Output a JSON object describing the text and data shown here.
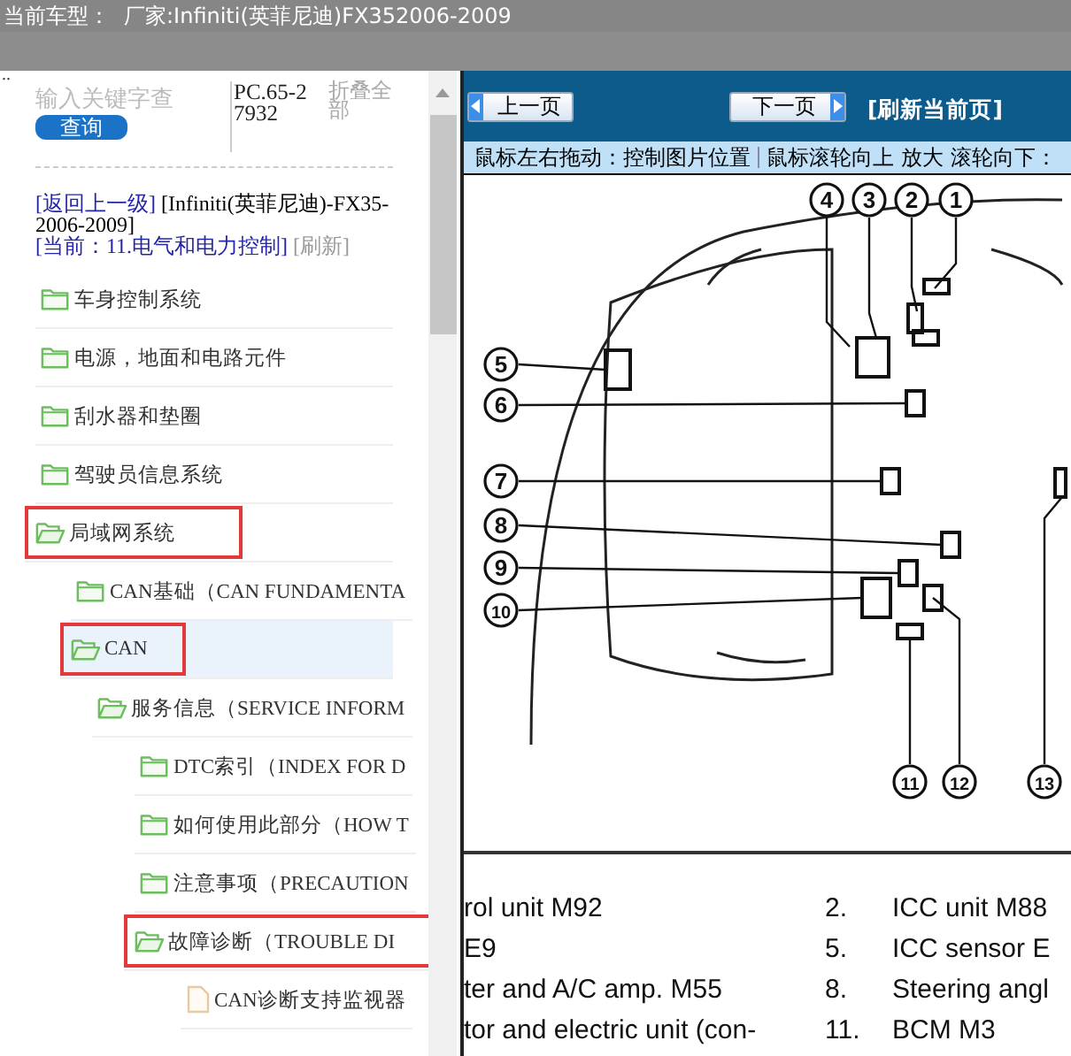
{
  "window": {
    "title_label": "当前车型：",
    "title": "厂家:Infiniti(英菲尼迪)FX352006-2009"
  },
  "sidebar": {
    "corner_mark": "..",
    "search": {
      "placeholder": "输入关键字查",
      "button": "查询"
    },
    "code": "PC.65-27932",
    "collapse_all": "折叠全部",
    "back_link": "[返回上一级]",
    "path": "[Infiniti(英菲尼迪)-FX35-2006-2009]",
    "current": "[当前：11.电气和电力控制]",
    "refresh": "[刷新]",
    "tree": [
      {
        "label": "车身控制系统",
        "kind": "folder",
        "expanded": false,
        "selected": false,
        "highlighted": false
      },
      {
        "label": "电源，地面和电路元件",
        "kind": "folder",
        "expanded": false,
        "selected": false,
        "highlighted": false
      },
      {
        "label": "刮水器和垫圈",
        "kind": "folder",
        "expanded": false,
        "selected": false,
        "highlighted": false
      },
      {
        "label": "驾驶员信息系统",
        "kind": "folder",
        "expanded": false,
        "selected": false,
        "highlighted": false
      },
      {
        "label": "局域网系统",
        "kind": "folder",
        "expanded": true,
        "selected": false,
        "highlighted": true,
        "children": [
          {
            "label": "CAN基础（CAN FUNDAMENTA",
            "kind": "folder",
            "expanded": false,
            "selected": false,
            "highlighted": false
          },
          {
            "label": "CAN",
            "kind": "folder",
            "expanded": true,
            "selected": true,
            "highlighted": true,
            "children": [
              {
                "label": "服务信息（SERVICE INFORM",
                "kind": "folder",
                "expanded": true,
                "selected": false,
                "highlighted": false,
                "children": [
                  {
                    "label": "DTC索引（INDEX FOR D",
                    "kind": "folder",
                    "expanded": false,
                    "selected": false,
                    "highlighted": false
                  },
                  {
                    "label": "如何使用此部分（HOW T",
                    "kind": "folder",
                    "expanded": false,
                    "selected": false,
                    "highlighted": false
                  },
                  {
                    "label": "注意事项（PRECAUTION",
                    "kind": "folder",
                    "expanded": false,
                    "selected": false,
                    "highlighted": false
                  },
                  {
                    "label": "故障诊断（TROUBLE DI",
                    "kind": "folder",
                    "expanded": true,
                    "selected": false,
                    "highlighted": true,
                    "children": [
                      {
                        "label": "CAN诊断支持监视器",
                        "kind": "file",
                        "expanded": false,
                        "selected": false,
                        "highlighted": false
                      }
                    ]
                  }
                ]
              }
            ]
          }
        ]
      }
    ]
  },
  "viewer": {
    "prev_button": "上一页",
    "next_button": "下一页",
    "refresh_page": "[刷新当前页]",
    "hints": [
      "鼠标左右拖动：控制图片位置",
      "鼠标滚轮向上 放大",
      "滚轮向下："
    ],
    "callouts": [
      "4",
      "3",
      "2",
      "1",
      "5",
      "6",
      "7",
      "8",
      "9",
      "10",
      "11",
      "12",
      "13"
    ],
    "legend": [
      {
        "left": "rol unit M92",
        "num": "2.",
        "right": "ICC unit M88"
      },
      {
        "left": "E9",
        "num": "5.",
        "right": "ICC sensor E"
      },
      {
        "left": "ter and A/C amp. M55",
        "num": "8.",
        "right": "Steering angl"
      },
      {
        "left": "tor and electric unit (con-",
        "num": "11.",
        "right": "BCM M3"
      }
    ]
  }
}
